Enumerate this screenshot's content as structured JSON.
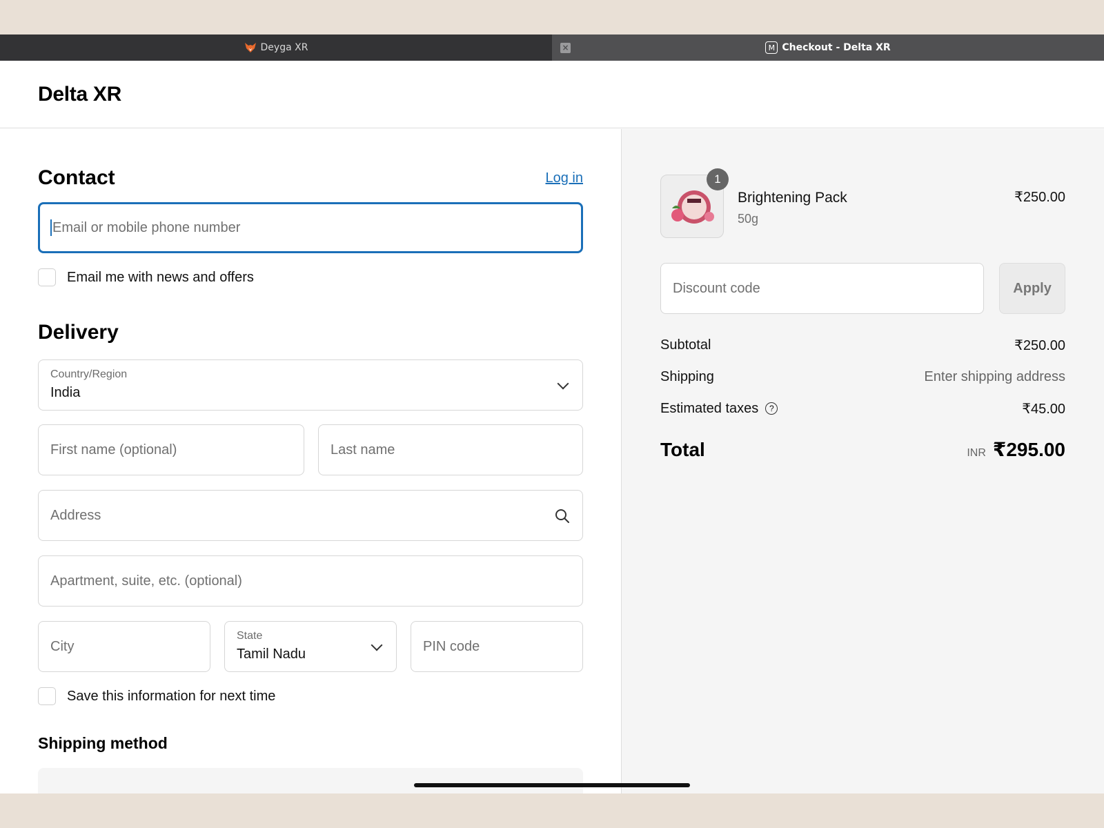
{
  "browser": {
    "tabs": [
      {
        "label": "Deyga XR"
      },
      {
        "label": "Checkout - Delta XR",
        "favicon_letter": "M"
      }
    ]
  },
  "header": {
    "store_name": "Delta XR"
  },
  "contact": {
    "title": "Contact",
    "login_label": "Log in",
    "email_placeholder": "Email or mobile phone number",
    "newsletter_label": "Email me with news and offers"
  },
  "delivery": {
    "title": "Delivery",
    "country_label": "Country/Region",
    "country_value": "India",
    "first_name_placeholder": "First name (optional)",
    "last_name_placeholder": "Last name",
    "address_placeholder": "Address",
    "apartment_placeholder": "Apartment, suite, etc. (optional)",
    "city_placeholder": "City",
    "state_label": "State",
    "state_value": "Tamil Nadu",
    "pin_placeholder": "PIN code",
    "save_info_label": "Save this information for next time"
  },
  "shipping_method": {
    "title": "Shipping method"
  },
  "summary": {
    "product": {
      "name": "Brightening Pack",
      "variant": "50g",
      "price": "₹250.00",
      "quantity": "1"
    },
    "discount_placeholder": "Discount code",
    "apply_label": "Apply",
    "subtotal_label": "Subtotal",
    "subtotal_value": "₹250.00",
    "shipping_label": "Shipping",
    "shipping_value": "Enter shipping address",
    "taxes_label": "Estimated taxes",
    "taxes_value": "₹45.00",
    "total_label": "Total",
    "currency": "INR",
    "total_value": "₹295.00"
  },
  "colors": {
    "accent": "#1a6fb8",
    "tab_bar": "#3a3a3c",
    "summary_bg": "#f5f5f5"
  }
}
